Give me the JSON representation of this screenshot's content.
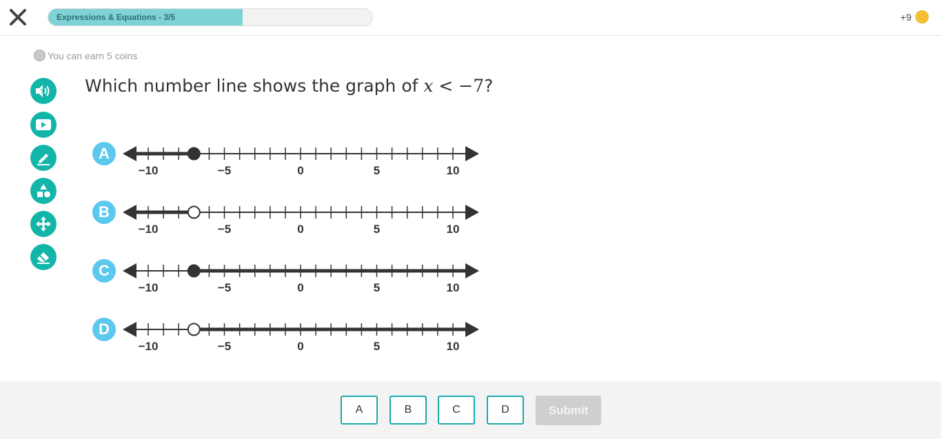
{
  "header": {
    "progress_label": "Expressions & Equations - 3/5",
    "progress_fraction": 0.6,
    "coins_earned": "+9"
  },
  "earn": {
    "text": "You can earn 5 coins"
  },
  "tools": [
    "audio-help",
    "video",
    "pencil",
    "shapes",
    "move",
    "eraser"
  ],
  "question": {
    "prefix": "Which number line shows the graph of ",
    "var": "x",
    "relation": " < −7",
    "suffix": "?"
  },
  "number_line": {
    "min": -11,
    "max": 11,
    "labels": [
      "−10",
      "−5",
      "0",
      "5",
      "10"
    ],
    "label_values": [
      -10,
      -5,
      0,
      5,
      10
    ]
  },
  "options": [
    {
      "letter": "A",
      "point": -7,
      "closed": true,
      "direction": "left"
    },
    {
      "letter": "B",
      "point": -7,
      "closed": false,
      "direction": "left"
    },
    {
      "letter": "C",
      "point": -7,
      "closed": true,
      "direction": "right"
    },
    {
      "letter": "D",
      "point": -7,
      "closed": false,
      "direction": "right"
    }
  ],
  "footer": {
    "answers": [
      "A",
      "B",
      "C",
      "D"
    ],
    "submit_label": "Submit"
  },
  "colors": {
    "accent": "#13b5a9",
    "option_badge": "#5bc8ed",
    "progress_fill": "#7fd3d6",
    "line": "#333333"
  }
}
